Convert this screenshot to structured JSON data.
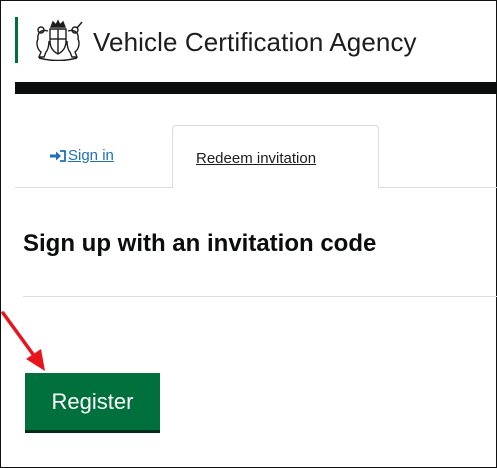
{
  "header": {
    "agency_name": "Vehicle Certification Agency",
    "crest_icon": "royal-coat-of-arms-icon"
  },
  "tabs": [
    {
      "label": "Sign in",
      "icon": "sign-in-arrow-icon",
      "active": false
    },
    {
      "label": "Redeem invitation",
      "active": true
    }
  ],
  "main": {
    "title": "Sign up with an invitation code",
    "register_label": "Register"
  },
  "annotation": {
    "arrow_icon": "red-pointer-arrow-icon"
  },
  "colors": {
    "brand_green": "#00703c",
    "link_blue": "#1d70b8",
    "header_bar": "#0b0c0c",
    "arrow_red": "#e8141b"
  }
}
